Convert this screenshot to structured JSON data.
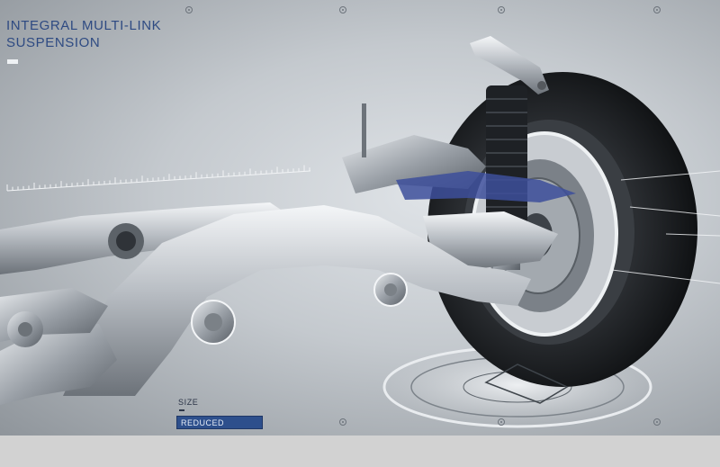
{
  "overlay": {
    "title_line1": "INTEGRAL MULTI-LINK",
    "title_line2": "SUSPENSION",
    "size_label": "SIZE",
    "size_value": "REDUCED"
  },
  "colors": {
    "title_blue": "#2e4a82",
    "selection_blue": "#2d4f8c",
    "background_gray": "#c4c9ce"
  },
  "illustration": {
    "subject": "rear-suspension-assembly"
  }
}
